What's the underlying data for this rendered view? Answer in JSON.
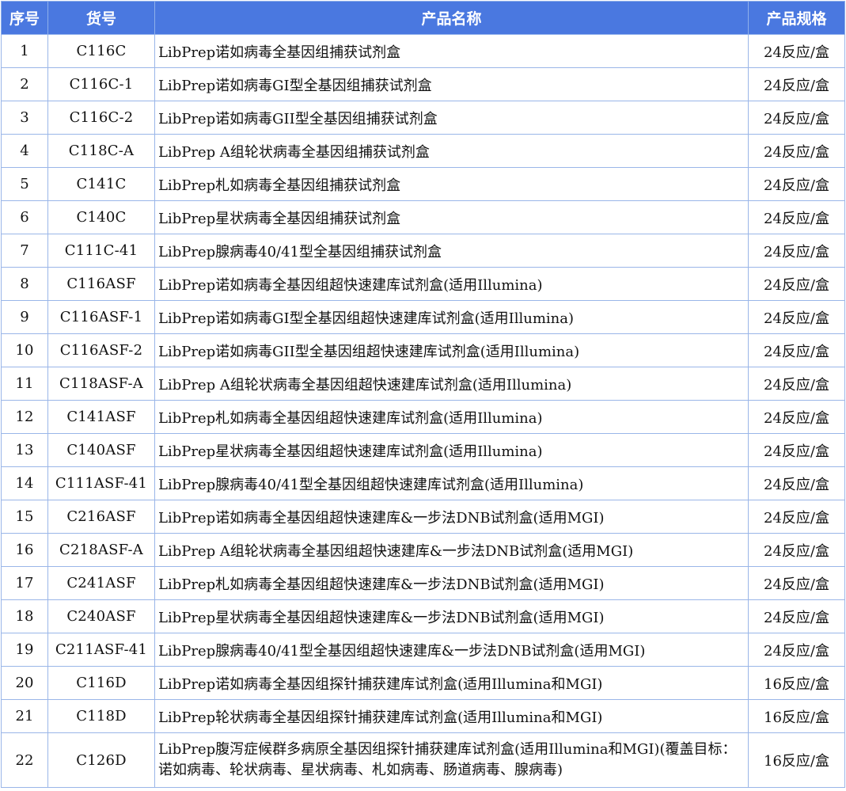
{
  "table": {
    "headers": {
      "num": "序号",
      "code": "货号",
      "name": "产品名称",
      "spec": "产品规格"
    },
    "rows": [
      {
        "num": "1",
        "code": "C116C",
        "name": "LibPrep诺如病毒全基因组捕获试剂盒",
        "spec": "24反应/盒"
      },
      {
        "num": "2",
        "code": "C116C-1",
        "name": "LibPrep诺如病毒GI型全基因组捕获试剂盒",
        "spec": "24反应/盒"
      },
      {
        "num": "3",
        "code": "C116C-2",
        "name": "LibPrep诺如病毒GII型全基因组捕获试剂盒",
        "spec": "24反应/盒"
      },
      {
        "num": "4",
        "code": "C118C-A",
        "name": "LibPrep A组轮状病毒全基因组捕获试剂盒",
        "spec": "24反应/盒"
      },
      {
        "num": "5",
        "code": "C141C",
        "name": "LibPrep札如病毒全基因组捕获试剂盒",
        "spec": "24反应/盒"
      },
      {
        "num": "6",
        "code": "C140C",
        "name": "LibPrep星状病毒全基因组捕获试剂盒",
        "spec": "24反应/盒"
      },
      {
        "num": "7",
        "code": "C111C-41",
        "name": "LibPrep腺病毒40/41型全基因组捕获试剂盒",
        "spec": "24反应/盒"
      },
      {
        "num": "8",
        "code": "C116ASF",
        "name": "LibPrep诺如病毒全基因组超快速建库试剂盒(适用Illumina)",
        "spec": "24反应/盒"
      },
      {
        "num": "9",
        "code": "C116ASF-1",
        "name": "LibPrep诺如病毒GI型全基因组超快速建库试剂盒(适用Illumina)",
        "spec": "24反应/盒"
      },
      {
        "num": "10",
        "code": "C116ASF-2",
        "name": "LibPrep诺如病毒GII型全基因组超快速建库试剂盒(适用Illumina)",
        "spec": "24反应/盒"
      },
      {
        "num": "11",
        "code": "C118ASF-A",
        "name": "LibPrep A组轮状病毒全基因组超快速建库试剂盒(适用Illumina)",
        "spec": "24反应/盒"
      },
      {
        "num": "12",
        "code": "C141ASF",
        "name": "LibPrep札如病毒全基因组超快速建库试剂盒(适用Illumina)",
        "spec": "24反应/盒"
      },
      {
        "num": "13",
        "code": "C140ASF",
        "name": "LibPrep星状病毒全基因组超快速建库试剂盒(适用Illumina)",
        "spec": "24反应/盒"
      },
      {
        "num": "14",
        "code": "C111ASF-41",
        "name": "LibPrep腺病毒40/41型全基因组超快速建库试剂盒(适用Illumina)",
        "spec": "24反应/盒"
      },
      {
        "num": "15",
        "code": "C216ASF",
        "name": "LibPrep诺如病毒全基因组超快速建库&一步法DNB试剂盒(适用MGI)",
        "spec": "24反应/盒"
      },
      {
        "num": "16",
        "code": "C218ASF-A",
        "name": "LibPrep A组轮状病毒全基因组超快速建库&一步法DNB试剂盒(适用MGI)",
        "spec": "24反应/盒"
      },
      {
        "num": "17",
        "code": "C241ASF",
        "name": "LibPrep札如病毒全基因组超快速建库&一步法DNB试剂盒(适用MGI)",
        "spec": "24反应/盒"
      },
      {
        "num": "18",
        "code": "C240ASF",
        "name": "LibPrep星状病毒全基因组超快速建库&一步法DNB试剂盒(适用MGI)",
        "spec": "24反应/盒"
      },
      {
        "num": "19",
        "code": "C211ASF-41",
        "name": "LibPrep腺病毒40/41型全基因组超快速建库&一步法DNB试剂盒(适用MGI)",
        "spec": "24反应/盒"
      },
      {
        "num": "20",
        "code": "C116D",
        "name": "LibPrep诺如病毒全基因组探针捕获建库试剂盒(适用Illumina和MGI)",
        "spec": "16反应/盒"
      },
      {
        "num": "21",
        "code": "C118D",
        "name": "LibPrep轮状病毒全基因组探针捕获建库试剂盒(适用Illumina和MGI)",
        "spec": "16反应/盒"
      },
      {
        "num": "22",
        "code": "C126D",
        "name": "LibPrep腹泻症候群多病原全基因组探针捕获建库试剂盒(适用Illumina和MGI)(覆盖目标：诺如病毒、轮状病毒、星状病毒、札如病毒、肠道病毒、腺病毒)",
        "spec": "16反应/盒"
      }
    ]
  }
}
